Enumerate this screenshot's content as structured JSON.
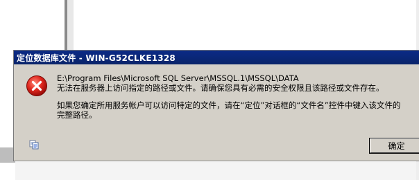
{
  "dialog": {
    "title": "定位数据库文件 - WIN-G52CLKE1328",
    "path_line": "E:\\Program Files\\Microsoft SQL Server\\MSSQL.1\\MSSQL\\DATA",
    "message_1": "无法在服务器上访问指定的路径或文件。请确保您具有必需的安全权限且该路径或文件存在。",
    "message_2": "如果您确定所用服务帐户可以访问特定的文件，请在“定位”对话框的“文件名”控件中键入该文件的",
    "message_3": "完整路径。",
    "ok_label": "确定",
    "error_icon": "error-x-icon",
    "copy_icon": "copy-icon"
  },
  "colors": {
    "titlebar": "#0a246a",
    "dialog_bg": "#d4d0c8",
    "error_red": "#d8201c"
  }
}
